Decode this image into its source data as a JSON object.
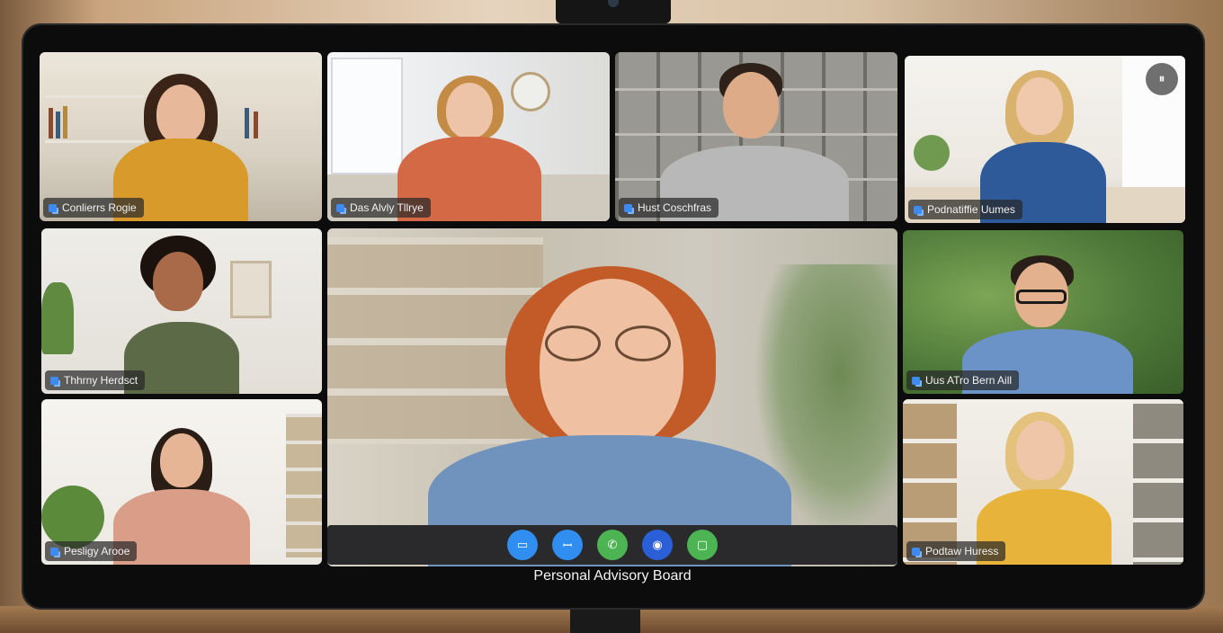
{
  "meeting": {
    "title": "Personal Advisory Board",
    "menu_label": "⏸"
  },
  "participants": [
    {
      "name": "Conlierrs Rogie",
      "shirt": "#d79a2b",
      "hair": "#3a2418",
      "bg": "#e8e2d6"
    },
    {
      "name": "Das Alvly Tllrye",
      "shirt": "#d46a45",
      "hair": "#c48b45",
      "bg": "#eef0f1"
    },
    {
      "name": "Hust Coschfras",
      "shirt": "#b8b8b8",
      "hair": "#2e2119",
      "bg": "#7d7c78"
    },
    {
      "name": "Podnatiffie Uumes",
      "shirt": "#2e5a9a",
      "hair": "#d9b26e",
      "bg": "#f1eee8"
    },
    {
      "name": "Thhrny Herdsct",
      "shirt": "#5d6a48",
      "hair": "#1b120d",
      "bg": "#e9e6e0"
    },
    {
      "name": "Uus ATro Bern Aill",
      "shirt": "#6c93c7",
      "hair": "#2a1f18",
      "bg": "#4f7a3a"
    },
    {
      "name": "Pesligy Arooe",
      "shirt": "#d99d88",
      "hair": "#2a1d16",
      "bg": "#f2efe9"
    },
    {
      "name": "Podtaw Huress",
      "shirt": "#e8b33a",
      "hair": "#e4c27c",
      "bg": "#eeeae3"
    }
  ],
  "featured": {
    "shirt": "#6f93bd",
    "hair": "#c25b28",
    "bg": "#cbc4b6"
  },
  "controls": [
    {
      "name": "chat-button",
      "icon": "chat-icon",
      "symbol": "▭",
      "color": "#2f8ef0"
    },
    {
      "name": "participants-button",
      "icon": "people-icon",
      "symbol": "ꟷ",
      "color": "#2f8ef0"
    },
    {
      "name": "call-button",
      "icon": "phone-icon",
      "symbol": "✆",
      "color": "#4cb452"
    },
    {
      "name": "record-button",
      "icon": "record-icon",
      "symbol": "◉",
      "color": "#2b5fd8"
    },
    {
      "name": "share-screen-button",
      "icon": "screen-icon",
      "symbol": "▢",
      "color": "#4cb452"
    }
  ]
}
